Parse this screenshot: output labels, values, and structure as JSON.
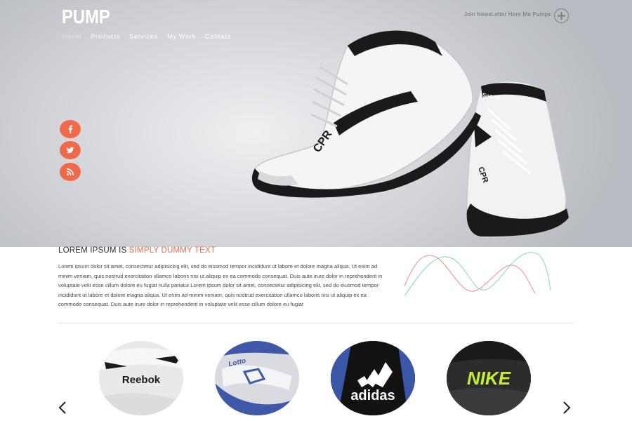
{
  "header": {
    "logo": "PUMP",
    "nav": [
      {
        "label": "Home"
      },
      {
        "label": "Products"
      },
      {
        "label": "Services"
      },
      {
        "label": "My Work"
      },
      {
        "label": "Contact"
      }
    ],
    "newsletter_text": "Join NewsLetter Here Ma Pumps"
  },
  "social": [
    {
      "name": "facebook",
      "glyph": "f"
    },
    {
      "name": "twitter",
      "glyph": "bird"
    },
    {
      "name": "rss",
      "glyph": "rss"
    }
  ],
  "hero": {
    "shoe_text_1": "CPR",
    "shoe_text_2": "Sports",
    "shoe_text_3": "CPR"
  },
  "intro": {
    "headline_prefix": "LOREM IPSUM IS ",
    "headline_accent": "SIMPLY DUMMY TEXT",
    "body": "Lorem ipsum dolor sit amet, consectetur adipisicing elit, sed do eiusmod tempor incididunt ut labore et dolore magna aliqua. Ut enim ad minim veniam, quis nostrud exercitation ullamco laboris nisi ut aliquip ex ea commodo consequat. Duis aute irure dolor in reprehenderit in voluptate velit esse cillum dolore eu fugiat nulla pariatur.Lorem ipsum dolor sit amet, consectetur adipisicing elit, sed do eiusmod tempor incididunt ut labore et dolore magna aliqua. Ut enim ad minim veniam, quis nostrud exercitation ullamco laboris nisi ut aliquip ex ea commodo consequat. Duis aute irure dolor in reprehenderit in voluptate velit esse cillum dolore eu fugiat"
  },
  "brands": [
    {
      "name": "Reebok"
    },
    {
      "name": "Lotto"
    },
    {
      "name": "adidas"
    },
    {
      "name": "NIKE"
    }
  ],
  "colors": {
    "accent": "#ee6a4a",
    "wave_red": "#f08a84",
    "wave_cyan": "#7fd0d8"
  }
}
